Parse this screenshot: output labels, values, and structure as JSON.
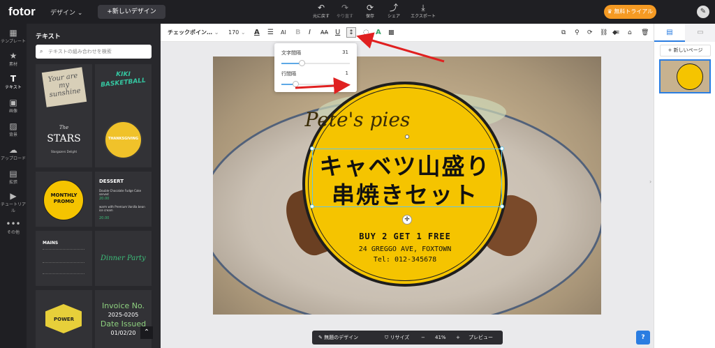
{
  "header": {
    "logo": "fotor",
    "design_menu": "デザイン",
    "new_design": "+新しいデザイン",
    "actions": [
      {
        "icon": "↶",
        "label": "元に戻す"
      },
      {
        "icon": "↷",
        "label": "やり直す"
      },
      {
        "icon": "⟳",
        "label": "保存"
      },
      {
        "icon": "⤴",
        "label": "シェア"
      },
      {
        "icon": "⤓",
        "label": "エクスポート"
      }
    ],
    "trial": "無料トライアル"
  },
  "left_nav": [
    {
      "icon": "▦",
      "label": "テンプレート"
    },
    {
      "icon": "★",
      "label": "素材"
    },
    {
      "icon": "T",
      "label": "テキスト"
    },
    {
      "icon": "▣",
      "label": "画像"
    },
    {
      "icon": "▨",
      "label": "背景"
    },
    {
      "icon": "☁",
      "label": "アップロード"
    },
    {
      "icon": "▤",
      "label": "拡張"
    },
    {
      "icon": "▶",
      "label": "チュートリアル"
    },
    {
      "icon": "•••",
      "label": "その他"
    }
  ],
  "panel": {
    "title": "テキスト",
    "search_placeholder": "テキストの組み合わせを検索",
    "tiles": {
      "t1": "Your are my sunshine",
      "t2a": "KIKI",
      "t2b": "BASKETBALL",
      "t3a": "The",
      "t3b": "STARS",
      "t3c": "Stargazers Delight",
      "t4a": "THANKSGIVING",
      "t5a": "MONTHLY",
      "t5b": "PROMO",
      "t6a": "DESSERT",
      "t6b": "Double Chocolate Fudge Cake served",
      "t6c": "20.00",
      "t6d": "warm with Premium Vanilla bean ice cream",
      "t6e": "20.00",
      "t7a": "MAINS",
      "t8a": "Dinner Party",
      "t9a": "POWER",
      "t10a": "Invoice No.",
      "t10b": "2025-0205",
      "t10c": "Date Issued",
      "t10d": "01/02/20"
    }
  },
  "toolbar": {
    "font": "チェックポイン…",
    "size": "170"
  },
  "popup": {
    "letter_spacing_label": "文字間隔",
    "letter_spacing": "31",
    "line_spacing_label": "行間隔",
    "line_spacing": "1",
    "letter_spacing_level": 0.3,
    "line_spacing_level": 0.2
  },
  "design": {
    "script": "Pete's pies",
    "line1": "キャベツ山盛り",
    "line2": "串焼きセット",
    "promo": "BUY 2 GET 1 FREE",
    "address": "24 GREGGO AVE, FOXTOWN",
    "tel": "Tel: 012-345678"
  },
  "bottom": {
    "name": "無題のデザイン",
    "resize": "リサイズ",
    "zoom": "41%",
    "preview": "プレビュー"
  },
  "right": {
    "new_page": "+ 新しいページ"
  },
  "colors": {
    "accent": "#f59a23",
    "badge": "#f5c400",
    "arrow": "#e02020"
  }
}
